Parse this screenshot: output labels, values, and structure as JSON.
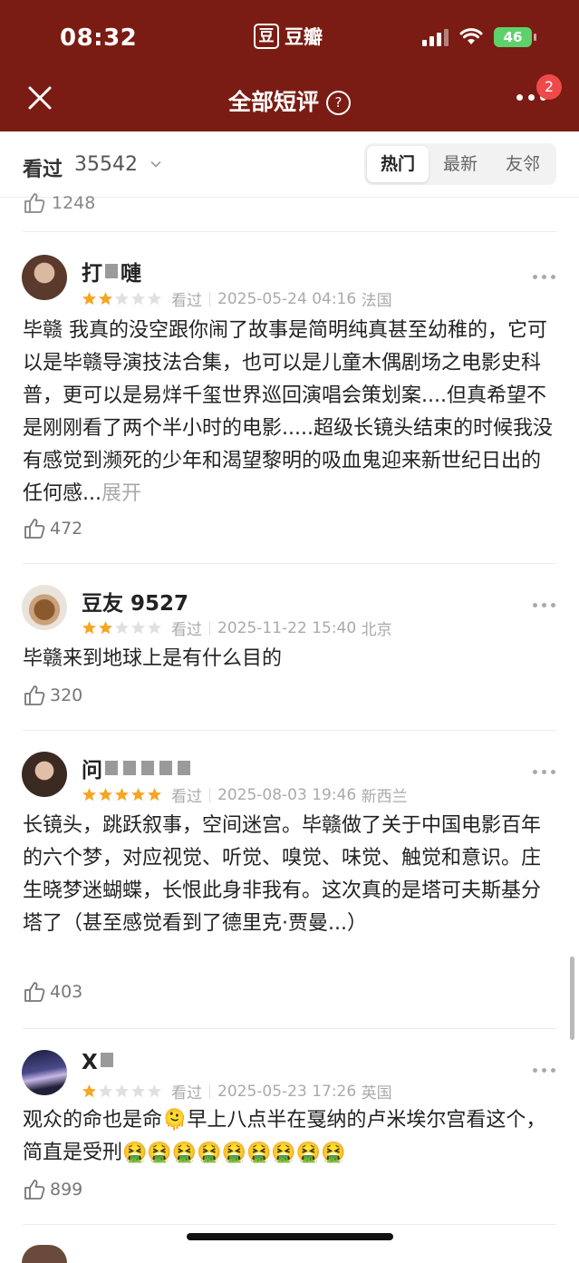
{
  "status_bar": {
    "time": "08:32",
    "brand_icon": "豆",
    "brand_text": "豆瓣",
    "battery": "46"
  },
  "nav": {
    "title": "全部短评",
    "help_glyph": "?",
    "notification_count": "2"
  },
  "subheader": {
    "seen_label": "看过",
    "seen_count": "35542",
    "tabs": [
      {
        "label": "热门",
        "active": true
      },
      {
        "label": "最新",
        "active": false
      },
      {
        "label": "友邻",
        "active": false
      }
    ]
  },
  "partial_previous": {
    "likes": "1248"
  },
  "reviews": [
    {
      "username": "打 ▮ 嗹",
      "rating": 2,
      "status": "看过",
      "date": "2025-05-24 04:16",
      "location": "法国",
      "text": "毕赣 我真的没空跟你闹了故事是简明纯真甚至幼稚的，它可以是毕赣导演技法合集，也可以是儿童木偶剧场之电影史科普，更可以是易烊千玺世界巡回演唱会策划案....但真希望不是刚刚看了两个半小时的电影.....超级长镜头结束的时候我没有感觉到濒死的少年和渴望黎明的吸血鬼迎来新世纪日出的任何感...",
      "expand_label": "展开",
      "likes": "472"
    },
    {
      "username": "豆友 9527",
      "rating": 2,
      "status": "看过",
      "date": "2025-11-22 15:40",
      "location": "北京",
      "text": "毕赣来到地球上是有什么目的",
      "likes": "320"
    },
    {
      "username": "问▮▮▮▮▮▮",
      "rating": 5,
      "status": "看过",
      "date": "2025-08-03 19:46",
      "location": "新西兰",
      "text": "长镜头，跳跃叙事，空间迷宫。毕赣做了关于中国电影百年的六个梦，对应视觉、听觉、嗅觉、味觉、触觉和意识。庄生晓梦迷蝴蝶，长恨此身非我有。这次真的是塔可夫斯基分塔了（甚至感觉看到了德里克·贾曼...）",
      "likes": "403"
    },
    {
      "username": "X▮",
      "rating": 1,
      "status": "看过",
      "date": "2025-05-23 17:26",
      "location": "英国",
      "text": "观众的命也是命🫠早上八点半在戛纳的卢米埃尔宫看这个，简直是受刑🤮🤮🤮🤮🤮🤮🤮🤮🤮",
      "likes": "899"
    }
  ],
  "colors": {
    "header_bg": "#7a1c13",
    "star_on": "#f5a623",
    "star_off": "#e0e0e0",
    "badge": "#ef4a4a"
  },
  "icons": [
    "close-icon",
    "help-icon",
    "more-icon",
    "chevron-down-icon",
    "kebab-icon",
    "thumb-up-icon",
    "star-icon",
    "signal-icon",
    "wifi-icon",
    "battery-icon"
  ]
}
